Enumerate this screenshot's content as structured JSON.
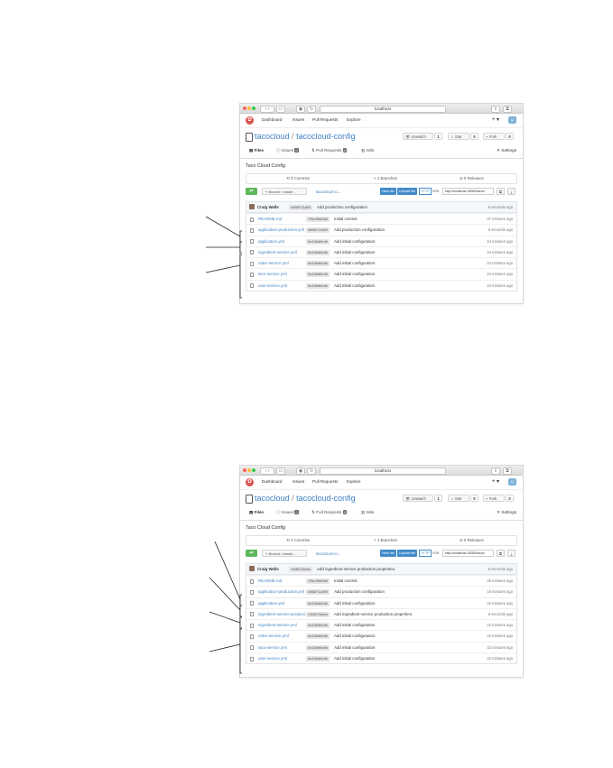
{
  "screens": [
    {
      "browser": {
        "url": "localhost"
      },
      "nav": {
        "items": [
          "Dashboard",
          "Issues",
          "Pull Requests",
          "Explore"
        ],
        "plus": "+ ▾"
      },
      "repo": {
        "owner": "tacocloud",
        "separator": "/",
        "name": "tacocloud-config",
        "unwatch": "Unwatch",
        "watch_count": "1",
        "star": "Star",
        "star_count": "0",
        "fork": "Fork",
        "fork_count": "0"
      },
      "tabs": {
        "files": "Files",
        "issues": "Issues",
        "issues_count": "0",
        "pulls": "Pull Requests",
        "pulls_count": "0",
        "wiki": "Wiki",
        "settings": "Settings"
      },
      "description": "Taco Cloud Config",
      "stats": {
        "commits": "3 Commits",
        "branches": "1 Branches",
        "releases": "0 Releases"
      },
      "toolbar": {
        "branch": "Branch: master ▾",
        "crumb": "tacocloud-co...",
        "new_file": "New file",
        "upload_file": "Upload file",
        "http": "HTTP",
        "ssh": "SSH",
        "clone_url": "http://localhost:10080/tacoc"
      },
      "latest_commit": {
        "author": "Craig Walls",
        "sha": "b808f12a69",
        "message": "Add production configuration",
        "time": "5 seconds ago"
      },
      "files": [
        {
          "name": "README.md",
          "sha": "f9bc9669b8",
          "message": "Initial commit",
          "time": "37 minutes ago"
        },
        {
          "name": "application-production.yml",
          "sha": "b808f12a69",
          "message": "Add production configuration",
          "time": "5 seconds ago"
        },
        {
          "name": "application.yml",
          "sha": "0a106d6ed6",
          "message": "Add initial configuration",
          "time": "24 minutes ago"
        },
        {
          "name": "ingredient-service.yml",
          "sha": "0a106d6ed6",
          "message": "Add initial configuration",
          "time": "24 minutes ago"
        },
        {
          "name": "order-service.yml",
          "sha": "0a106d6ed6",
          "message": "Add initial configuration",
          "time": "24 minutes ago"
        },
        {
          "name": "taco-service.yml",
          "sha": "0a106d6ed6",
          "message": "Add initial configuration",
          "time": "24 minutes ago"
        },
        {
          "name": "user-service.yml",
          "sha": "0a106d6ed6",
          "message": "Add initial configuration",
          "time": "24 minutes ago"
        }
      ]
    },
    {
      "browser": {
        "url": "localhost"
      },
      "nav": {
        "items": [
          "Dashboard",
          "Issues",
          "Pull Requests",
          "Explore"
        ],
        "plus": "+ ▾"
      },
      "repo": {
        "owner": "tacocloud",
        "separator": "/",
        "name": "tacocloud-config",
        "unwatch": "Unwatch",
        "watch_count": "1",
        "star": "Star",
        "star_count": "0",
        "fork": "Fork",
        "fork_count": "0"
      },
      "tabs": {
        "files": "Files",
        "issues": "Issues",
        "issues_count": "0",
        "pulls": "Pull Requests",
        "pulls_count": "0",
        "wiki": "Wiki",
        "settings": "Settings"
      },
      "description": "Taco Cloud Config",
      "stats": {
        "commits": "4 Commits",
        "branches": "1 Branches",
        "releases": "0 Releases"
      },
      "toolbar": {
        "branch": "Branch: master ▾",
        "crumb": "tacocloud-co...",
        "new_file": "New file",
        "upload_file": "Upload file",
        "http": "HTTP",
        "ssh": "SSH",
        "clone_url": "http://localhost:10080/tacoc"
      },
      "latest_commit": {
        "author": "Craig Walls",
        "sha": "c6d6f2abba",
        "message": "Add ingredient service production properties.",
        "time": "5 seconds ago"
      },
      "files": [
        {
          "name": "README.md",
          "sha": "f9bc9669b8",
          "message": "Initial commit",
          "time": "45 minutes ago"
        },
        {
          "name": "application-production.yml",
          "sha": "b808f12a69",
          "message": "Add production configuration",
          "time": "16 minutes ago"
        },
        {
          "name": "application.yml",
          "sha": "0a106d6ed6",
          "message": "Add initial configuration",
          "time": "42 minutes ago"
        },
        {
          "name": "ingredient-service-producti...",
          "sha": "c6d6f2abba",
          "message": "Add ingredient service production properties.",
          "time": "5 seconds ago"
        },
        {
          "name": "ingredient-service.yml",
          "sha": "0a106d6ed6",
          "message": "Add initial configuration",
          "time": "42 minutes ago"
        },
        {
          "name": "order-service.yml",
          "sha": "0a106d6ed6",
          "message": "Add initial configuration",
          "time": "42 minutes ago"
        },
        {
          "name": "taco-service.yml",
          "sha": "0a106d6ed6",
          "message": "Add initial configuration",
          "time": "42 minutes ago"
        },
        {
          "name": "user-service.yml",
          "sha": "0a106d6ed6",
          "message": "Add initial configuration",
          "time": "42 minutes ago"
        }
      ]
    }
  ]
}
